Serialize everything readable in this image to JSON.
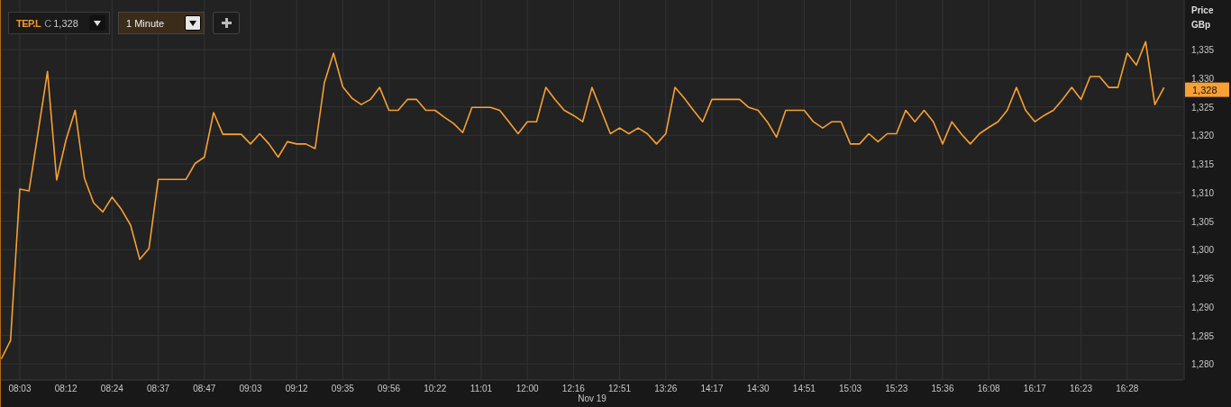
{
  "toolbar": {
    "price_prefix": "C",
    "price": "1,328",
    "interval": "1 Minute"
  },
  "y_axis": {
    "title": "Price",
    "unit": "GBp",
    "last_price": "1,328"
  },
  "date_label": "Nov 19",
  "x_axis_labels": [
    "08:03",
    "08:12",
    "08:24",
    "08:37",
    "08:47",
    "09:03",
    "09:12",
    "09:35",
    "09:56",
    "10:22",
    "11:01",
    "12:00",
    "12:16",
    "12:51",
    "13:26",
    "14:17",
    "14:30",
    "14:51",
    "15:03",
    "15:23",
    "15:36",
    "16:08",
    "16:17",
    "16:23",
    "16:28"
  ],
  "chart_data": {
    "type": "line",
    "grid": true,
    "ylim": [
      1277.2,
      1343.7
    ],
    "yticks": [
      {
        "value": 1280,
        "label": "1,280"
      },
      {
        "value": 1285,
        "label": "1,285"
      },
      {
        "value": 1290,
        "label": "1,290"
      },
      {
        "value": 1295,
        "label": "1,295"
      },
      {
        "value": 1300,
        "label": "1,300"
      },
      {
        "value": 1305,
        "label": "1,305"
      },
      {
        "value": 1310,
        "label": "1,310"
      },
      {
        "value": 1315,
        "label": "1,315"
      },
      {
        "value": 1320,
        "label": "1,320"
      },
      {
        "value": 1325,
        "label": "1,325"
      },
      {
        "value": 1330,
        "label": "1,330"
      },
      {
        "value": 1335,
        "label": "1,335"
      }
    ],
    "series": [
      {
        "name": "TEP.L",
        "color": "#f7a035",
        "values": [
          1280.9,
          1284.1,
          1310.6,
          1310.3,
          1320.8,
          1331.2,
          1312.2,
          1319.2,
          1324.4,
          1312.5,
          1308.2,
          1306.6,
          1309.2,
          1307.1,
          1304.3,
          1298.3,
          1300.2,
          1312.3,
          1312.3,
          1312.3,
          1312.3,
          1315.1,
          1316.2,
          1324.0,
          1320.2,
          1320.2,
          1320.2,
          1318.5,
          1320.3,
          1318.5,
          1316.2,
          1318.9,
          1318.5,
          1318.5,
          1317.7,
          1329.2,
          1334.4,
          1328.5,
          1326.5,
          1325.4,
          1326.3,
          1328.4,
          1324.4,
          1324.4,
          1326.3,
          1326.3,
          1324.4,
          1324.4,
          1323.2,
          1322.1,
          1320.5,
          1324.9,
          1324.9,
          1324.9,
          1324.4,
          1322.4,
          1320.3,
          1322.4,
          1322.4,
          1328.4,
          1326.3,
          1324.4,
          1323.5,
          1322.4,
          1328.4,
          1324.4,
          1320.3,
          1321.3,
          1320.3,
          1321.3,
          1320.3,
          1318.5,
          1320.3,
          1328.4,
          1326.5,
          1324.4,
          1322.4,
          1326.3,
          1326.3,
          1326.3,
          1326.3,
          1324.9,
          1324.4,
          1322.4,
          1319.7,
          1324.4,
          1324.4,
          1324.4,
          1322.4,
          1321.3,
          1322.4,
          1322.4,
          1318.5,
          1318.5,
          1320.3,
          1318.9,
          1320.3,
          1320.3,
          1324.4,
          1322.4,
          1324.4,
          1322.4,
          1318.5,
          1322.4,
          1320.3,
          1318.5,
          1320.3,
          1321.4,
          1322.4,
          1324.4,
          1328.4,
          1324.4,
          1322.4,
          1323.5,
          1324.4,
          1326.3,
          1328.4,
          1326.3,
          1330.3,
          1330.3,
          1328.4,
          1328.4,
          1334.4,
          1332.3,
          1336.4,
          1325.4,
          1328.4
        ]
      }
    ]
  }
}
